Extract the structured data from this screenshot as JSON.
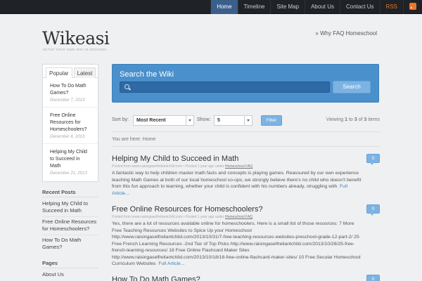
{
  "topnav": [
    "Home",
    "Timeline",
    "Site Map",
    "About Us",
    "Contact Us",
    "RSS"
  ],
  "site": {
    "title": "Wikeasi",
    "tagline": "SETUP YOUR OWN WIKI IN SECONDS"
  },
  "header_link": "» Why FAQ Homeschool",
  "sidebar": {
    "tabs": [
      "Popular",
      "Latest"
    ],
    "popular": [
      {
        "title": "How To Do Math Games?",
        "date": "December 7, 2013"
      },
      {
        "title": "Free Online Resources for Homeschoolers?",
        "date": "December 8, 2013"
      },
      {
        "title": "Helping My Child to Succeed in Math",
        "date": "December 21, 2013"
      }
    ],
    "recent_heading": "Recent Posts",
    "recent": [
      "Helping My Child to Succeed in Math",
      "Free Online Resources for Homeschoolers?",
      "How To Do Math Games?"
    ],
    "pages_heading": "Pages",
    "pages": [
      "About Us"
    ]
  },
  "search": {
    "title": "Search the Wiki",
    "button": "Search",
    "placeholder": ""
  },
  "filters": {
    "sort_label": "Sort by:",
    "sort_value": "Most Recent",
    "show_label": "Show:",
    "show_value": "5",
    "button": "Filter",
    "viewing_prefix": "Viewing ",
    "viewing_from": "1",
    "viewing_to_word": " to ",
    "viewing_to": "3",
    "viewing_of_word": " of ",
    "viewing_total": "3",
    "viewing_suffix": " items"
  },
  "breadcrumb": "You are here:  Home",
  "posts": [
    {
      "title": "Helping My Child to Succeed in Math",
      "meta_prefix": "Posted from www.raisingaselfreliantchild.com • Posted 1 year ago under ",
      "category": "Homeschool FAQ",
      "excerpt": "A fantastic way to help children master math facts and concepts is playing games. Reassured by our own experience teaching Math Games at both of our local homeschool co-ops, we strongly believe there's no child who doesn't benefit from this fun approach to learning, whether your child is confident with his numbers already, struggling with",
      "more": "Full Article...",
      "comments": "0"
    },
    {
      "title": "Free Online Resources for Homeschoolers?",
      "meta_prefix": "Posted from www.raisingaselfreliantchild.com • Posted 1 year ago under ",
      "category": "Homeschool FAQ",
      "excerpt": "Yes, there are a lot of resources available online for homeschoolers. Here is a small list of those resources: 7 More Free Teaching Resources Websites to Spice Up your Homeschool http://www.raisingaselfreliantchild.com/2013/10/31/7-free-teaching-resources-websites-preschool-grade-12-part-2/ 25 Free French Learning Resources -2nd Tier of Top Picks http://www.raisingaselfreliantchild.com/2013/10/28/25-free-french-learning-resources/ 18 Free Online Flashcard Maker Sites http://www.raisingaselfreliantchild.com/2013/10/18/18-free-online-flashcard-maker-sites/ 10 Free Secular Homeschool Curriculum Websites",
      "more": "Full Article...",
      "comments": "0"
    },
    {
      "title": "How To Do Math Games?",
      "comments": "0"
    }
  ]
}
